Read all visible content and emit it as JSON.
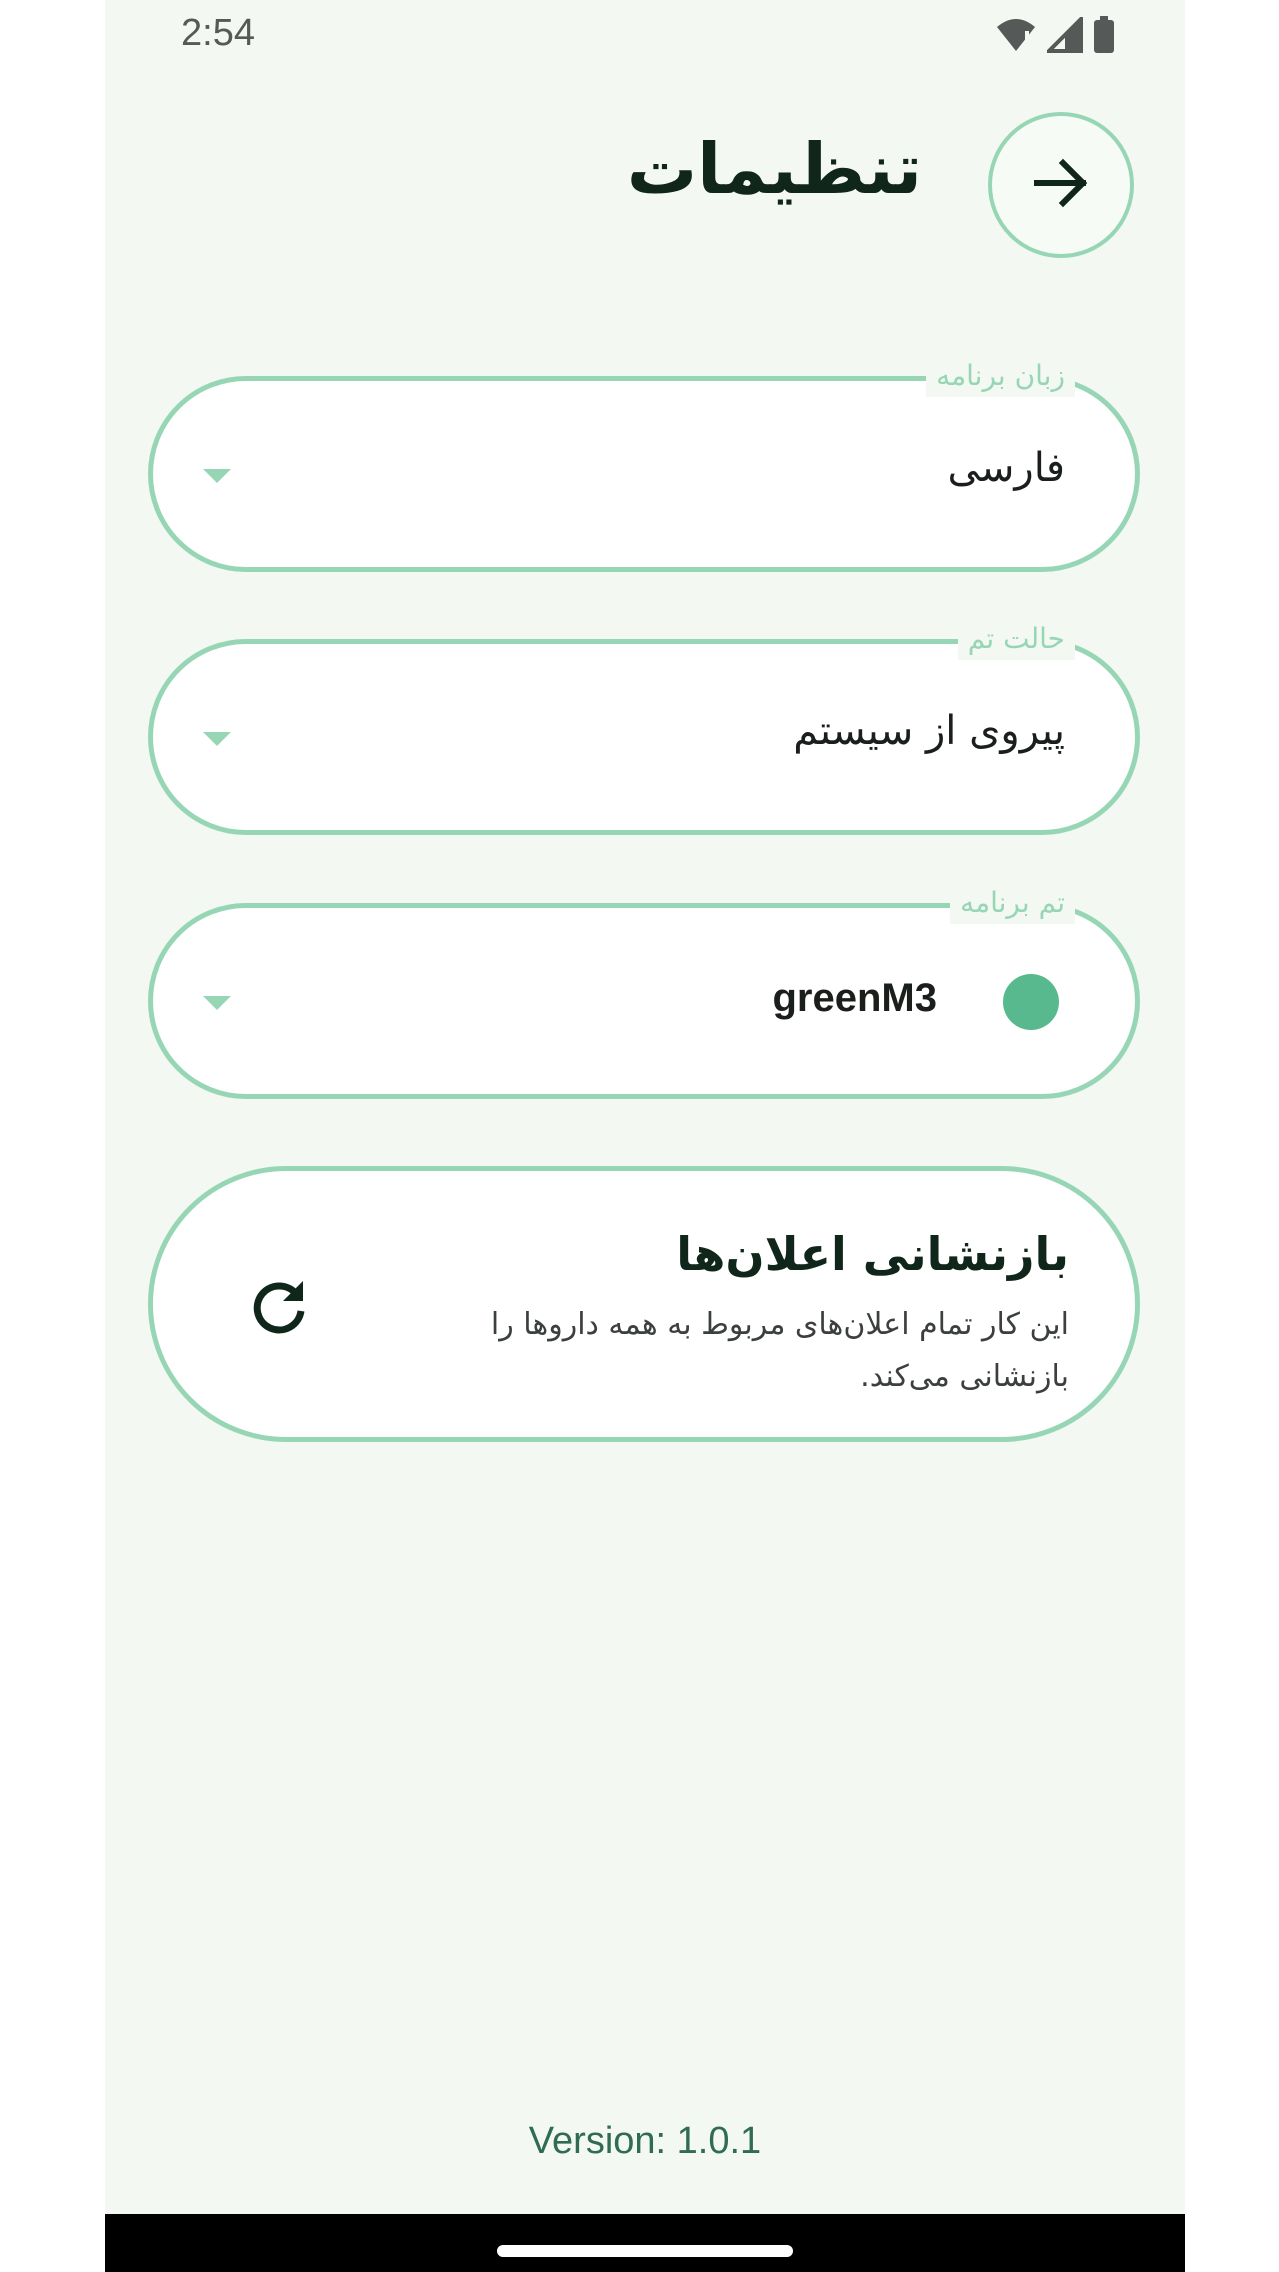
{
  "status_bar": {
    "time": "2:54",
    "icons": [
      "wifi-alert-icon",
      "signal-icon",
      "battery-icon"
    ]
  },
  "header": {
    "title": "تنظیمات",
    "back_icon": "arrow-right-icon"
  },
  "settings": {
    "language": {
      "label": "زبان برنامه",
      "value": "فارسی"
    },
    "theme_mode": {
      "label": "حالت تم",
      "value": "پیروی از سیستم"
    },
    "app_theme": {
      "label": "تم برنامه",
      "value": "greenM3",
      "swatch_color": "#57b98d"
    },
    "reset_notifications": {
      "title": "بازنشانی اعلان‌ها",
      "description": "این کار تمام اعلان‌های مربوط به همه داروها را بازنشانی می‌کند.",
      "icon": "refresh-icon"
    }
  },
  "footer": {
    "version": "Version: 1.0.1"
  },
  "colors": {
    "accent_outline": "#97d6b4",
    "background": "#f3f8f2",
    "title_text": "#10261a",
    "version_text": "#2f6b55"
  }
}
